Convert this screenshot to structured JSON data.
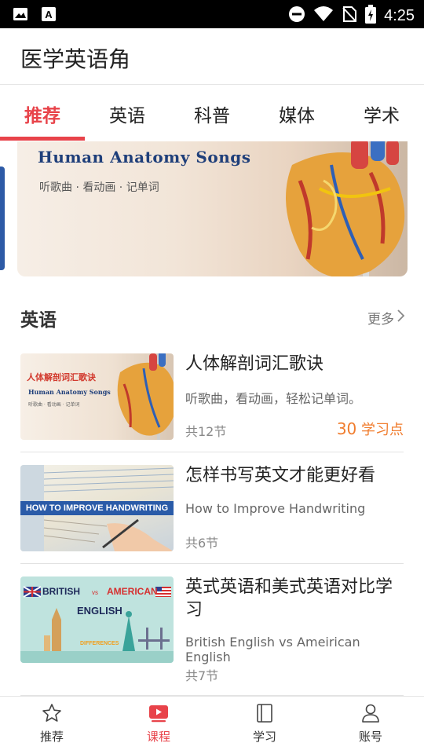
{
  "status_bar": {
    "time": "4:25",
    "icons": [
      "image-icon",
      "text-a-icon",
      "do-not-disturb-icon",
      "wifi-icon",
      "no-sim-icon",
      "battery-icon"
    ]
  },
  "app": {
    "title": "医学英语角"
  },
  "tabs": [
    {
      "label": "推荐",
      "active": true
    },
    {
      "label": "英语",
      "active": false
    },
    {
      "label": "科普",
      "active": false
    },
    {
      "label": "媒体",
      "active": false
    },
    {
      "label": "学术",
      "active": false
    }
  ],
  "banner": {
    "title": "Human Anatomy Songs",
    "subtitle": "听歌曲 · 看动画 · 记单词"
  },
  "section": {
    "title": "英语",
    "more_label": "更多"
  },
  "courses": [
    {
      "title": "人体解剖词汇歌诀",
      "description": "听歌曲，看动画，轻松记单词。",
      "lessons": "共12节",
      "points_value": "30",
      "points_unit": "学习点",
      "thumb": {
        "title": "人体解剖词汇歌诀",
        "subtitle": "Human Anatomy Songs",
        "tagline": "听歌曲 · 看动画 · 记单词"
      }
    },
    {
      "title": "怎样书写英文才能更好看",
      "description": "How to Improve Handwriting",
      "lessons": "共6节",
      "thumb": {
        "banner_text": "HOW TO IMPROVE HANDWRITING"
      }
    },
    {
      "title": "英式英语和美式英语对比学习",
      "description": "British English vs Ameirican English",
      "lessons": "共7节",
      "thumb": {
        "left": "BRITISH",
        "vs": "vs",
        "right": "AMERICAN",
        "center": "ENGLISH",
        "bottom": "DIFFERENCES"
      }
    }
  ],
  "bottom_nav": [
    {
      "label": "推荐",
      "icon": "star-icon",
      "active": false
    },
    {
      "label": "课程",
      "icon": "play-video-icon",
      "active": true
    },
    {
      "label": "学习",
      "icon": "book-icon",
      "active": false
    },
    {
      "label": "账号",
      "icon": "person-icon",
      "active": false
    }
  ],
  "colors": {
    "accent": "#e8434a",
    "points": "#f07c2d",
    "banner_title": "#1f3f7a"
  }
}
